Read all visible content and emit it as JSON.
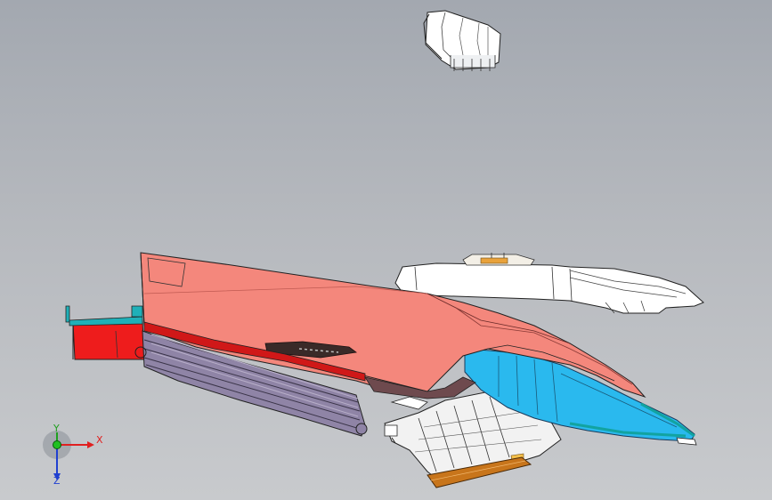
{
  "viewport": {
    "background_top": "#a3a8b0",
    "background_bottom": "#c8cacd"
  },
  "triad": {
    "x_label": "X",
    "y_label": "Y",
    "z_label": "Z",
    "x_color": "#e02020",
    "y_color": "#20a020",
    "z_color": "#2040d0"
  },
  "parts": [
    {
      "name": "upper-duct-part",
      "color": "#ffffff"
    },
    {
      "name": "main-pink-panel",
      "color": "#f4877c"
    },
    {
      "name": "red-bracket",
      "color": "#ee1c1c"
    },
    {
      "name": "purple-ribbed-hose",
      "color": "#8a7fa0"
    },
    {
      "name": "white-side-panel",
      "color": "#ffffff"
    },
    {
      "name": "cyan-duct",
      "color": "#22b8ee"
    },
    {
      "name": "white-ribbed-bracket",
      "color": "#f2f2f2"
    },
    {
      "name": "orange-base-strip",
      "color": "#d07a1a"
    }
  ]
}
